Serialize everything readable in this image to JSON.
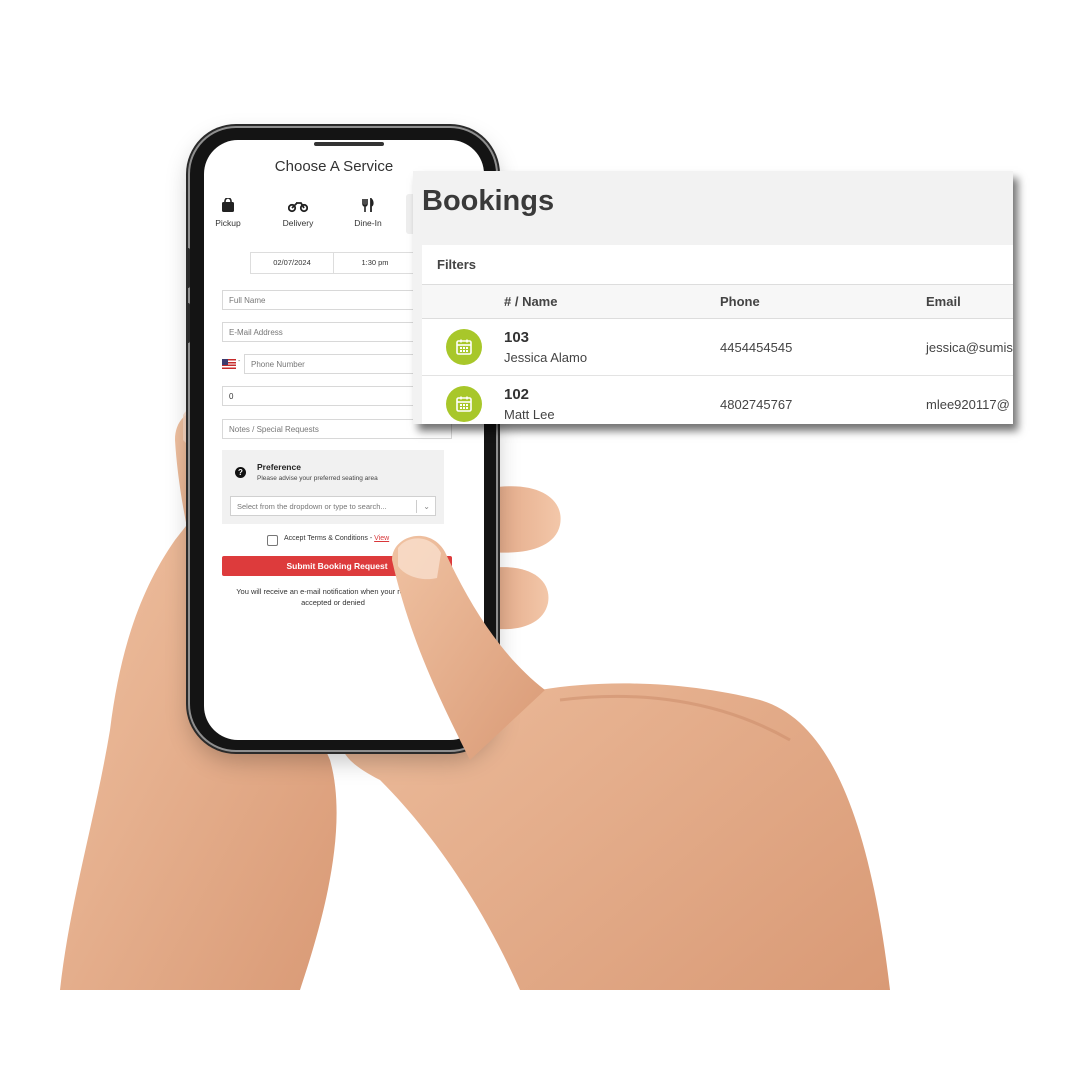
{
  "phone_form": {
    "title": "Choose A Service",
    "services": [
      {
        "label": "Pickup",
        "icon": "shopping-bag-icon"
      },
      {
        "label": "Delivery",
        "icon": "motorcycle-icon"
      },
      {
        "label": "Dine-In",
        "icon": "utensils-icon"
      }
    ],
    "date": "02/07/2024",
    "time": "1:30 pm",
    "fields": {
      "full_name_placeholder": "Full Name",
      "email_placeholder": "E-Mail Address",
      "phone_placeholder": "Phone Number",
      "party_size_value": "0",
      "notes_placeholder": "Notes / Special Requests"
    },
    "preference": {
      "title": "Preference",
      "subtitle": "Please advise your preferred seating area",
      "select_placeholder": "Select from the dropdown or type to search..."
    },
    "terms": {
      "label": "Accept Terms & Conditions - ",
      "link": "View"
    },
    "submit_label": "Submit Booking Request",
    "note": "You will receive an e-mail notification when your request is accepted or denied",
    "accent_color": "#dd3b3c"
  },
  "bookings_panel": {
    "title": "Bookings",
    "filters_label": "Filters",
    "columns": [
      "# / Name",
      "Phone",
      "Email"
    ],
    "rows": [
      {
        "number": "103",
        "name": "Jessica Alamo",
        "phone": "4454454545",
        "email": "jessica@sumis"
      },
      {
        "number": "102",
        "name": "Matt Lee",
        "phone": "4802745767",
        "email": "mlee920117@"
      }
    ],
    "icon": "calendar-icon",
    "icon_color": "#a8c72a"
  }
}
